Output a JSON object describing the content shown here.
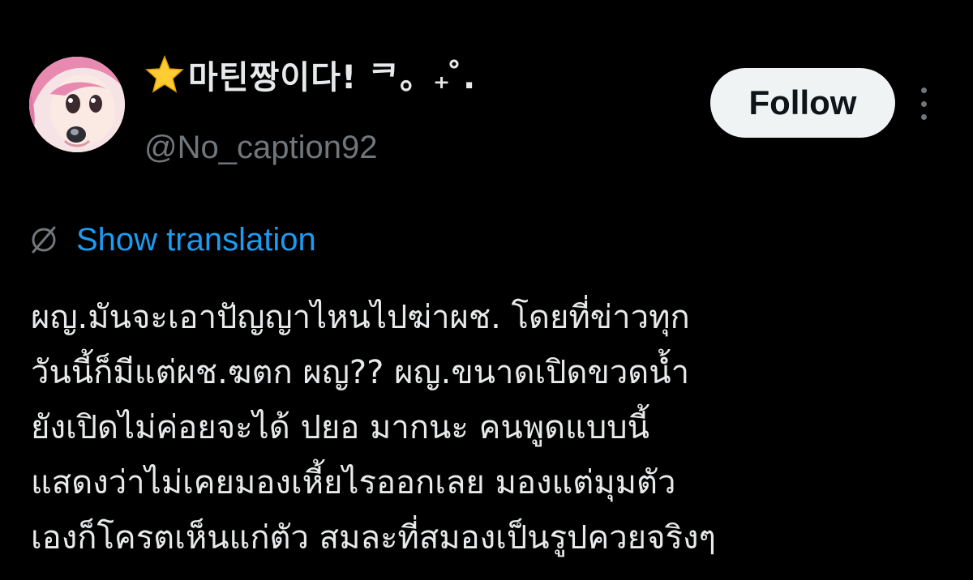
{
  "user": {
    "display_name": "마틴짱이다! ᄏ。₊ ̊.",
    "handle": "@No_caption92",
    "avatar_icon": "anime-avatar",
    "name_emoji": "star-icon"
  },
  "actions": {
    "follow_label": "Follow",
    "more_icon": "more-vertical-icon"
  },
  "translation": {
    "icon": "globe-icon",
    "label": "Show translation"
  },
  "tweet": {
    "lines": [
      "ผญ.มันจะเอาปัญญาไหนไปฆ่าผช. โดยที่ข่าวทุก",
      "วันนี้ก็มีแต่ผช.ฆตก ผญ?? ผญ.ขนาดเปิดขวดน้ำ",
      "ยังเปิดไม่ค่อยจะได้ ปยอ มากนะ คนพูดแบบนี้",
      "แสดงว่าไม่เคยมองเหี้ยไรออกเลย มองแต่มุมตัว",
      "เองก็โครตเห็นแก่ตัว สมละที่สมองเป็นรูปควยจริงๆ"
    ]
  },
  "colors": {
    "background": "#000000",
    "text": "#e7e9ea",
    "secondary": "#71767b",
    "link": "#1d9bf0",
    "follow_bg": "#eff3f4"
  }
}
